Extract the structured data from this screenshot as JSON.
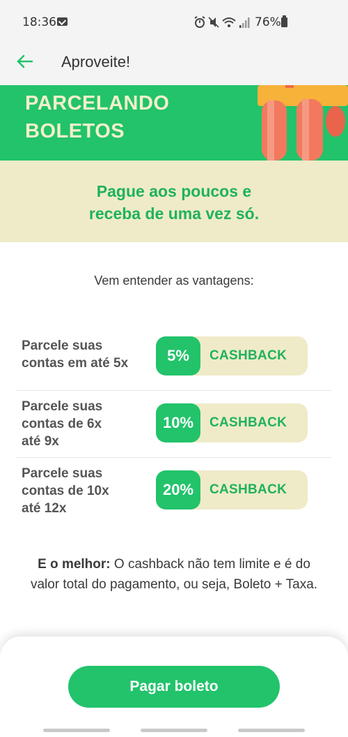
{
  "status_bar": {
    "time": "18:36",
    "icons": [
      "mail-icon",
      "alarm-icon",
      "mute-icon",
      "wifi-icon",
      "signal-icon"
    ],
    "battery": "76%"
  },
  "app_bar": {
    "title": "Aproveite!"
  },
  "hero": {
    "title_line1": "PARCELANDO",
    "title_line2": "BOLETOS"
  },
  "tagline": {
    "line1": "Pague aos poucos e",
    "line2": "receba de uma vez só."
  },
  "intro": "Vem entender as vantagens:",
  "benefits": [
    {
      "line1": "Parcele suas",
      "line2": "contas em até 5x",
      "line3": "",
      "percent": "5%",
      "label": "CASHBACK"
    },
    {
      "line1": "Parcele suas",
      "line2": "contas de 6x",
      "line3": "até 9x",
      "percent": "10%",
      "label": "CASHBACK"
    },
    {
      "line1": "Parcele suas",
      "line2": "contas de 10x",
      "line3": "até 12x",
      "percent": "20%",
      "label": "CASHBACK"
    }
  ],
  "note": {
    "strong": "E o melhor:",
    "text": " O cashback não tem limite e é do valor total do pagamento, ou seja, Boleto + Taxa."
  },
  "cta": {
    "pay_label": "Pagar boleto"
  },
  "colors": {
    "brand_green": "#22c36b",
    "cream": "#efebc8",
    "text_green": "#1fb25f"
  }
}
